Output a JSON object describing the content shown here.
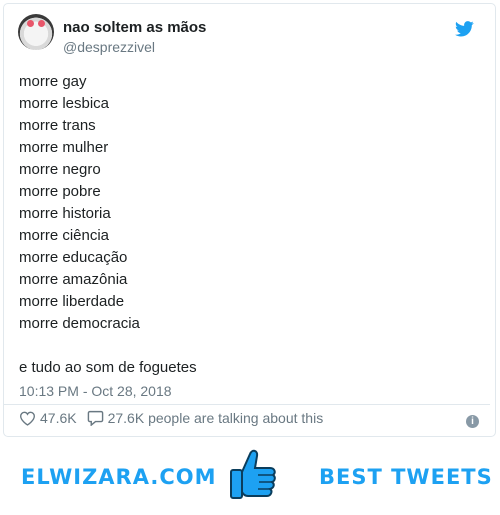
{
  "tweet": {
    "display_name": "nao soltem as mãos",
    "handle": "@desprezzivel",
    "lines": [
      "morre gay",
      "morre lesbica",
      "morre trans",
      "morre mulher",
      "morre negro",
      "morre pobre",
      "morre historia",
      "morre ciência",
      "morre educação",
      "morre amazônia",
      "morre liberdade",
      "morre democracia"
    ],
    "closing_line": "e tudo ao som de foguetes",
    "timestamp": "10:13 PM - Oct 28, 2018",
    "likes": "47.6K",
    "talking": "27.6K people are talking about this",
    "info_glyph": "i"
  },
  "icons": {
    "brand": "twitter-bird-icon",
    "like": "heart-icon",
    "reply": "speech-bubble-icon",
    "info": "info-icon",
    "banner": "thumbs-up-icon"
  },
  "banner": {
    "left_text": "ELWIZARA.COM",
    "right_text": "BEST TWEETS"
  },
  "colors": {
    "accent": "#1da1f2",
    "muted": "#697882",
    "text": "#1c2022",
    "border": "#e1e8ed"
  }
}
